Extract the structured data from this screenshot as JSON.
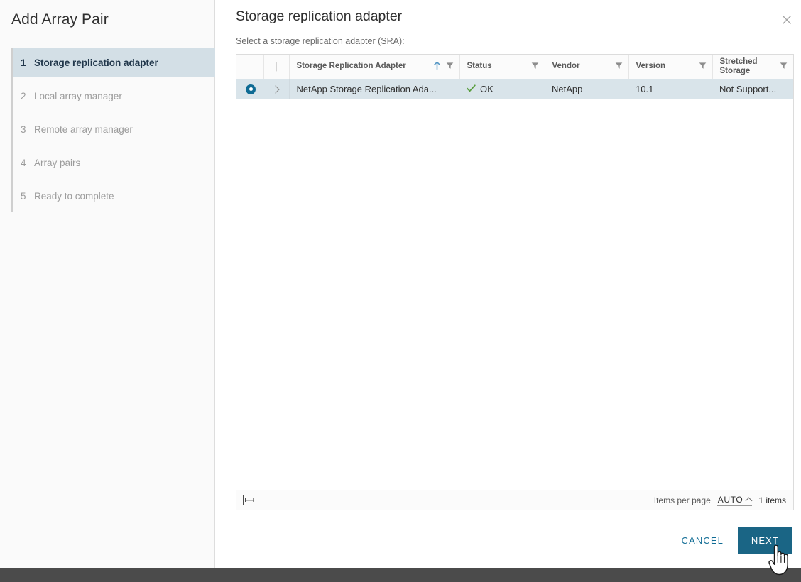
{
  "wizard": {
    "title": "Add Array Pair",
    "steps": [
      {
        "num": "1",
        "label": "Storage replication adapter",
        "active": true
      },
      {
        "num": "2",
        "label": "Local array manager",
        "active": false
      },
      {
        "num": "3",
        "label": "Remote array manager",
        "active": false
      },
      {
        "num": "4",
        "label": "Array pairs",
        "active": false
      },
      {
        "num": "5",
        "label": "Ready to complete",
        "active": false
      }
    ]
  },
  "page": {
    "title": "Storage replication adapter",
    "subtitle": "Select a storage replication adapter (SRA):",
    "close_icon": "close-icon"
  },
  "grid": {
    "columns": [
      {
        "key": "select",
        "label": ""
      },
      {
        "key": "expand",
        "label": "│"
      },
      {
        "key": "name",
        "label": "Storage Replication Adapter",
        "sort": "ascending",
        "filter": true
      },
      {
        "key": "status",
        "label": "Status",
        "filter": true
      },
      {
        "key": "vendor",
        "label": "Vendor",
        "filter": true
      },
      {
        "key": "version",
        "label": "Version",
        "filter": true
      },
      {
        "key": "stretched",
        "label": "Stretched Storage",
        "filter": true
      }
    ],
    "rows": [
      {
        "selected": true,
        "name": "NetApp Storage Replication Ada...",
        "status": "OK",
        "status_icon": "check-icon",
        "vendor": "NetApp",
        "version": "10.1",
        "stretched": "Not Support..."
      }
    ],
    "footer": {
      "fit_columns_icon": "fit-columns-icon",
      "items_per_page_label": "Items per page",
      "items_per_page_value": "AUTO",
      "total_items": "1 items"
    }
  },
  "actions": {
    "cancel_label": "CANCEL",
    "next_label": "NEXT"
  },
  "colors": {
    "accent": "#0f6b94",
    "primary_button": "#1a6585",
    "selected_row": "#d9e4ea",
    "selected_step": "#d3dfe6",
    "status_ok": "#5a9e3f",
    "bottom_bar": "#4b4b4b"
  }
}
